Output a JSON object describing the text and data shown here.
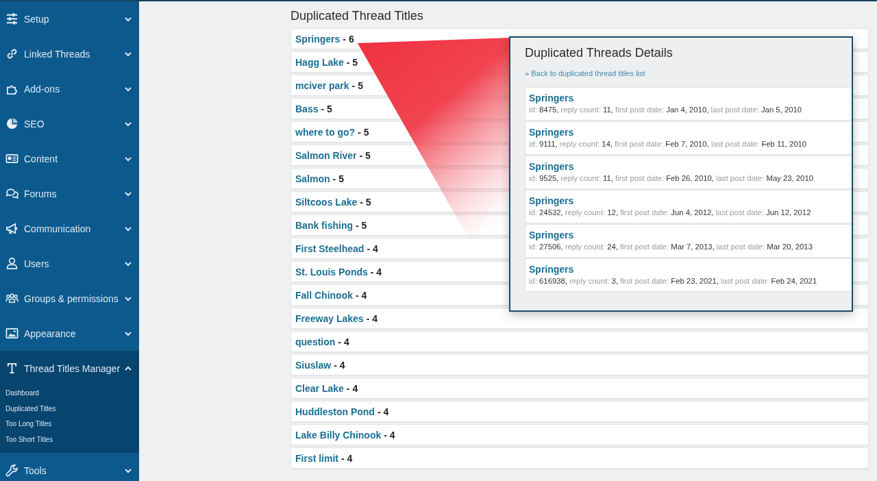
{
  "sidebar": {
    "items": [
      {
        "label": "Setup",
        "expanded": false
      },
      {
        "label": "Linked Threads",
        "expanded": false
      },
      {
        "label": "Add-ons",
        "expanded": false
      },
      {
        "label": "SEO",
        "expanded": false
      },
      {
        "label": "Content",
        "expanded": false
      },
      {
        "label": "Forums",
        "expanded": false
      },
      {
        "label": "Communication",
        "expanded": false
      },
      {
        "label": "Users",
        "expanded": false
      },
      {
        "label": "Groups & permissions",
        "expanded": false
      },
      {
        "label": "Appearance",
        "expanded": false
      },
      {
        "label": "Thread Titles Manager",
        "expanded": true,
        "children": [
          "Dashboard",
          "Duplicated Titles",
          "Too Long Titles",
          "Too Short Titles"
        ]
      },
      {
        "label": "Tools",
        "expanded": false
      }
    ]
  },
  "main": {
    "title": "Duplicated Thread Titles",
    "rows": [
      {
        "title": "Springers",
        "count": "- 6"
      },
      {
        "title": "Hagg Lake",
        "count": "- 5"
      },
      {
        "title": "mciver park",
        "count": "- 5"
      },
      {
        "title": "Bass",
        "count": "- 5"
      },
      {
        "title": "where to go?",
        "count": "- 5"
      },
      {
        "title": "Salmon River",
        "count": "- 5"
      },
      {
        "title": "Salmon",
        "count": "- 5"
      },
      {
        "title": "Siltcoos Lake",
        "count": "- 5"
      },
      {
        "title": "Bank fishing",
        "count": "- 5"
      },
      {
        "title": "First Steelhead",
        "count": "- 4"
      },
      {
        "title": "St. Louis Ponds",
        "count": "- 4"
      },
      {
        "title": "Fall Chinook",
        "count": "- 4"
      },
      {
        "title": "Freeway Lakes",
        "count": "- 4"
      },
      {
        "title": "question",
        "count": "- 4"
      },
      {
        "title": "Siuslaw",
        "count": "- 4"
      },
      {
        "title": "Clear Lake",
        "count": "- 4"
      },
      {
        "title": "Huddleston Pond",
        "count": "- 4"
      },
      {
        "title": "Lake Billy Chinook",
        "count": "- 4"
      },
      {
        "title": "First limit",
        "count": "- 4"
      }
    ]
  },
  "details": {
    "title": "Duplicated Threads Details",
    "back_link": "» Back to duplicated thread titles list",
    "threads": [
      {
        "title": "Springers",
        "fields": [
          {
            "label": "id:",
            "value": "8475,"
          },
          {
            "label": "reply count:",
            "value": "11,"
          },
          {
            "label": "first post date:",
            "value": "Jan 4, 2010,"
          },
          {
            "label": "last post date:",
            "value": "Jan 5, 2010"
          }
        ]
      },
      {
        "title": "Springers",
        "fields": [
          {
            "label": "id:",
            "value": "9111,"
          },
          {
            "label": "reply count:",
            "value": "14,"
          },
          {
            "label": "first post date:",
            "value": "Feb 7, 2010,"
          },
          {
            "label": "last post date:",
            "value": "Feb 11, 2010"
          }
        ]
      },
      {
        "title": "Springers",
        "fields": [
          {
            "label": "id:",
            "value": "9525,"
          },
          {
            "label": "reply count:",
            "value": "11,"
          },
          {
            "label": "first post date:",
            "value": "Feb 26, 2010,"
          },
          {
            "label": "last post date:",
            "value": "May 23, 2010"
          }
        ]
      },
      {
        "title": "Springers",
        "fields": [
          {
            "label": "id:",
            "value": "24532,"
          },
          {
            "label": "reply count:",
            "value": "12,"
          },
          {
            "label": "first post date:",
            "value": "Jun 4, 2012,"
          },
          {
            "label": "last post date:",
            "value": "Jun 12, 2012"
          }
        ]
      },
      {
        "title": "Springers",
        "fields": [
          {
            "label": "id:",
            "value": "27506,"
          },
          {
            "label": "reply count:",
            "value": "24,"
          },
          {
            "label": "first post date:",
            "value": "Mar 7, 2013,"
          },
          {
            "label": "last post date:",
            "value": "Mar 20, 2013"
          }
        ]
      },
      {
        "title": "Springers",
        "fields": [
          {
            "label": "id:",
            "value": "616938,"
          },
          {
            "label": "reply count:",
            "value": "3,"
          },
          {
            "label": "first post date:",
            "value": "Feb 23, 2021,"
          },
          {
            "label": "last post date:",
            "value": "Feb 24, 2021"
          }
        ]
      }
    ]
  }
}
